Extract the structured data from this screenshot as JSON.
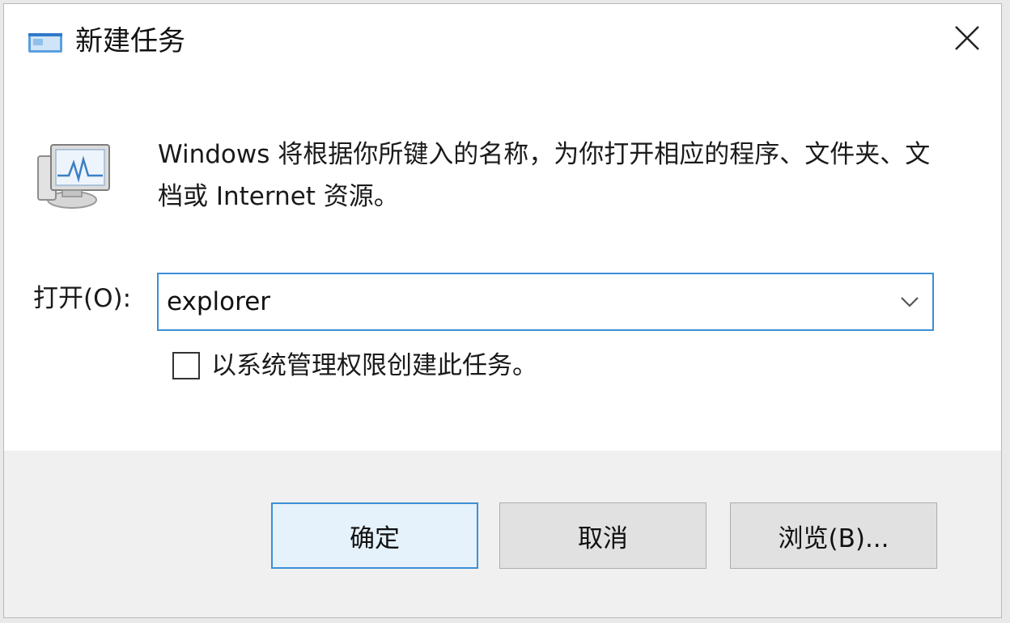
{
  "dialog": {
    "title": "新建任务",
    "close_label": "✕"
  },
  "content": {
    "description": "Windows 将根据你所键入的名称，为你打开相应的程序、文件夹、文档或 Internet 资源。",
    "open_label": "打开(O):",
    "open_value": "explorer",
    "admin_checkbox_label": "以系统管理权限创建此任务。",
    "admin_checked": false
  },
  "buttons": {
    "ok": "确定",
    "cancel": "取消",
    "browse": "浏览(B)..."
  },
  "colors": {
    "accent": "#3c8fd6",
    "primary_button_bg": "#e5f1fb",
    "footer_bg": "#f0f0f0"
  },
  "icons": {
    "title": "task-window-icon",
    "run": "run-monitor-icon",
    "close": "close-icon",
    "dropdown": "chevron-down-icon"
  }
}
